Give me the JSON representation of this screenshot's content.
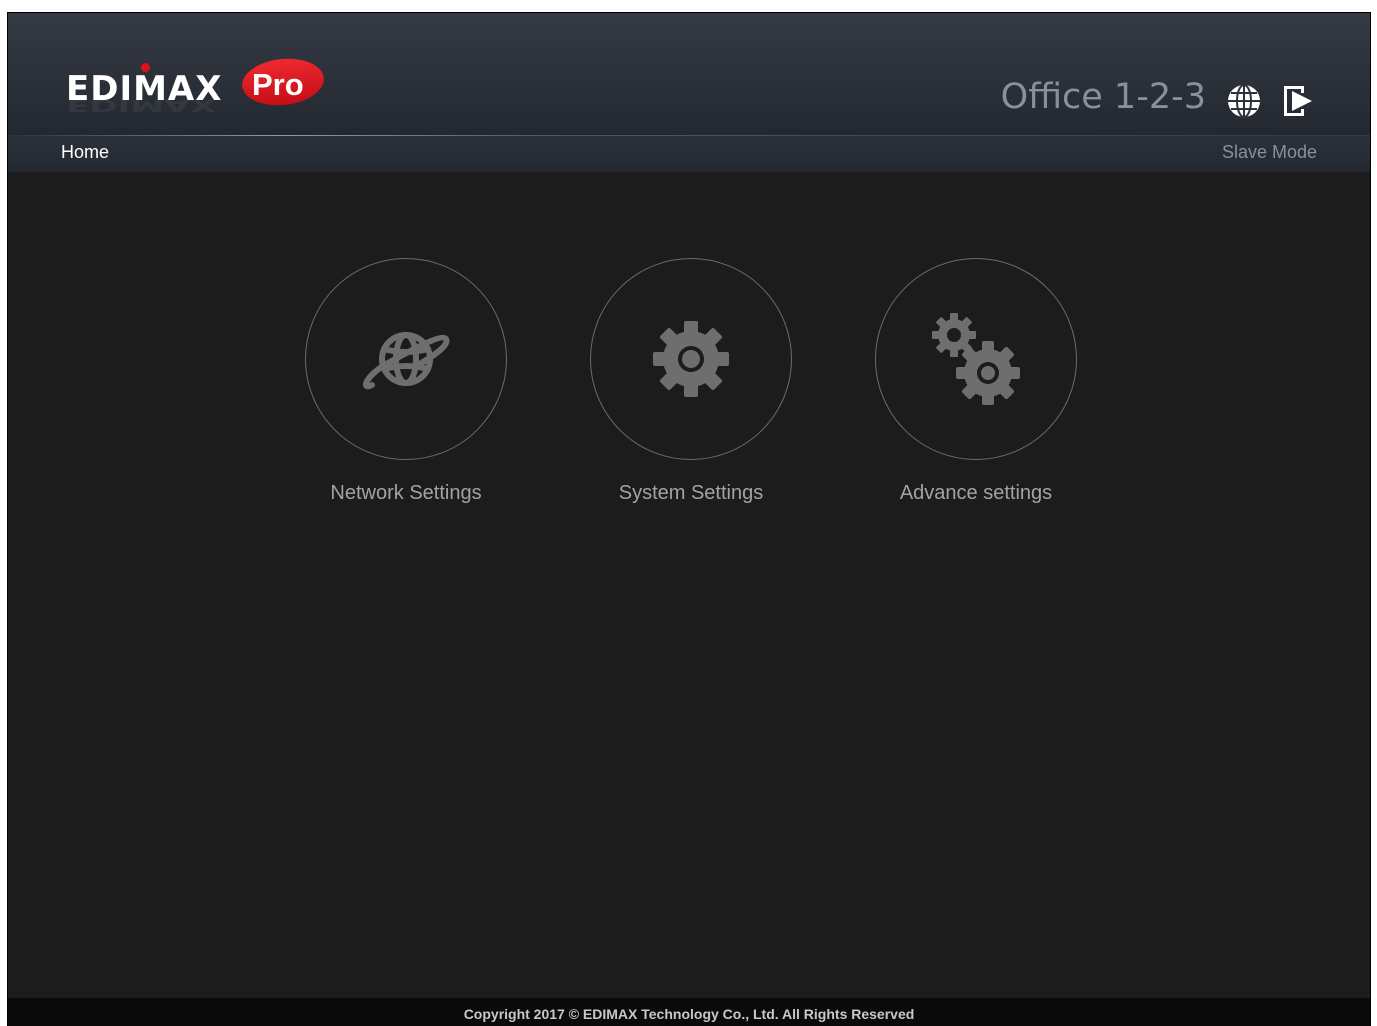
{
  "header": {
    "logo_text": "EDIMAX",
    "logo_pro": "Pro",
    "device_name": "Office 1-2-3",
    "globe_icon": "globe-icon",
    "logout_icon": "logout-icon"
  },
  "subbar": {
    "breadcrumb": "Home",
    "mode": "Slave Mode"
  },
  "tiles": [
    {
      "label": "Network Settings",
      "icon": "network-globe-icon"
    },
    {
      "label": "System Settings",
      "icon": "gear-icon"
    },
    {
      "label": "Advance settings",
      "icon": "gears-icon"
    }
  ],
  "footer": {
    "copyright": "Copyright 2017 © EDIMAX Technology Co., Ltd. All Rights Reserved"
  },
  "colors": {
    "background": "#1c1c1c",
    "header": "#2f343d",
    "accent_red": "#e3101c",
    "icon_grey": "#6e6e6e",
    "label_grey": "#a3a3a3"
  }
}
